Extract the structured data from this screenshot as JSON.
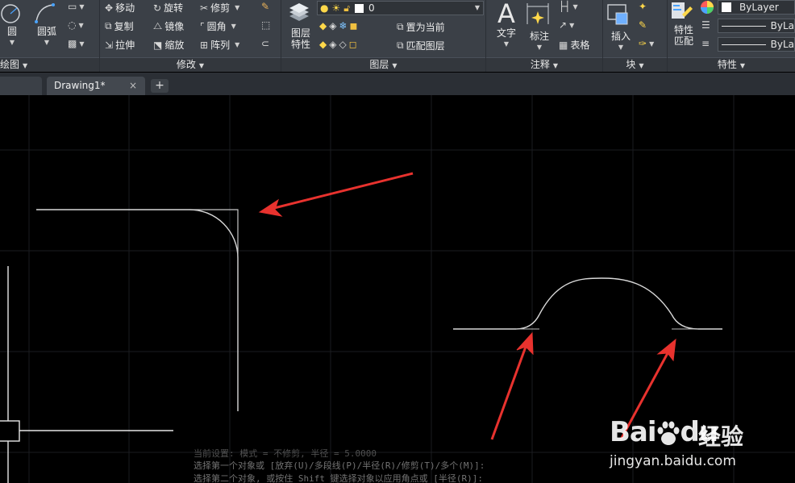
{
  "ribbon": {
    "draw": {
      "circle": "圆",
      "arc": "圆弧",
      "title": "绘图"
    },
    "modify": {
      "move": "移动",
      "rotate": "旋转",
      "trim": "修剪",
      "copy": "复制",
      "mirror": "镜像",
      "fillet": "圆角",
      "stretch": "拉伸",
      "scale": "缩放",
      "array": "阵列",
      "title": "修改"
    },
    "layers": {
      "layer_props": "图层\n特性",
      "layer_props_l1": "图层",
      "layer_props_l2": "特性",
      "current_layer": "0",
      "set_current": "置为当前",
      "match_layer": "匹配图层",
      "title": "图层"
    },
    "annotation": {
      "text": "文字",
      "dimension": "标注",
      "table": "表格",
      "title": "注释"
    },
    "block": {
      "insert": "插入",
      "title": "块"
    },
    "properties": {
      "match_l1": "特性",
      "match_l2": "匹配",
      "color": "ByLayer",
      "linetype": "ByLa",
      "lineweight": "ByLa",
      "title": "特性"
    }
  },
  "tabs": {
    "current": "Drawing1*",
    "close": "×",
    "add": "+"
  },
  "command_history": [
    "当前设置: 模式 = 不修剪, 半径 = 5.0000",
    "选择第一个对象或 [放弃(U)/多段线(P)/半径(R)/修剪(T)/多个(M)]:",
    "选择第二个对象, 或按住 Shift 键选择对象以应用角点或 [半径(R)]:"
  ],
  "watermark": {
    "brand": "Bai",
    "brand_du": "du",
    "cn": "经验",
    "url": "jingyan.baidu.com"
  },
  "colors": {
    "ribbon_bg": "#3b4047",
    "canvas_bg": "#000000",
    "annotation_arrow": "#e8322e",
    "geometry": "#e0e0e0"
  }
}
